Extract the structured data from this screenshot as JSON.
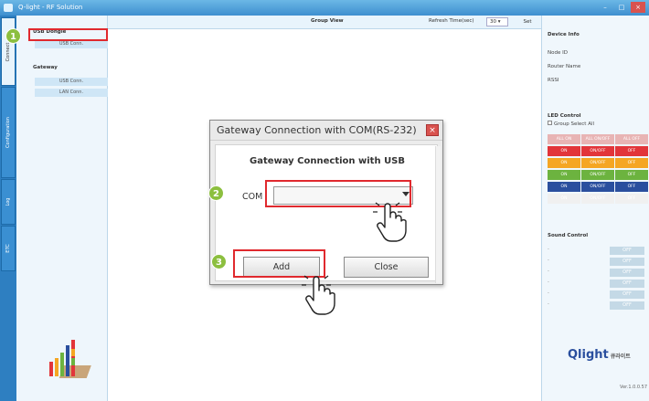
{
  "window": {
    "title": "Q-light - RF Solution"
  },
  "left_tabs": [
    "Connect",
    "Configuration",
    "Log",
    "ETC"
  ],
  "sidebar": {
    "usb_dongle": "USB Dongle",
    "usb_conn": "USB Conn.",
    "gateway": "Gateway",
    "gw_usb_conn": "USB Conn.",
    "gw_lan_conn": "LAN Conn."
  },
  "topbar": {
    "group_view": "Group View",
    "refresh_label": "Refresh Time(sec)",
    "refresh_value": "30",
    "set_label": "Set"
  },
  "device_info": {
    "title": "Device Info",
    "node_id": "Node ID",
    "router_name": "Router Name",
    "rssi": "RSSI"
  },
  "led_control": {
    "title": "LED Control",
    "group_select_all": "Group Select All",
    "rows": [
      {
        "color": "#f0f0f0",
        "labels": [
          "ALL ON",
          "ALL ON/OFF",
          "ALL OFF"
        ]
      },
      {
        "color": "#e2353a",
        "labels": [
          "ON",
          "ON/OFF",
          "OFF"
        ]
      },
      {
        "color": "#f5a623",
        "labels": [
          "ON",
          "ON/OFF",
          "OFF"
        ]
      },
      {
        "color": "#6cb33f",
        "labels": [
          "ON",
          "ON/OFF",
          "OFF"
        ]
      },
      {
        "color": "#2a4f9e",
        "labels": [
          "ON",
          "ON/OFF",
          "OFF"
        ]
      },
      {
        "color": "#f0f0f0",
        "labels": [
          "ON",
          "ON/OFF",
          "OFF"
        ]
      }
    ]
  },
  "sound_control": {
    "title": "Sound Control",
    "rows": [
      "-",
      "-",
      "-",
      "-",
      "-",
      "-"
    ],
    "off_label": "OFF"
  },
  "brand": {
    "logo": "Qlight",
    "sub": "큐라이트",
    "version": "Ver.1.0.0.57"
  },
  "dialog": {
    "title": "Gateway Connection with COM(RS-232)",
    "heading": "Gateway Connection with USB",
    "com_label": "COM",
    "com_value": "",
    "add_label": "Add",
    "close_label": "Close",
    "close_icon": "×"
  },
  "badges": [
    "1",
    "2",
    "3"
  ],
  "colors": {
    "accent": "#3e8fcf",
    "highlight": "#e0292e",
    "badge": "#8cbf3f"
  }
}
